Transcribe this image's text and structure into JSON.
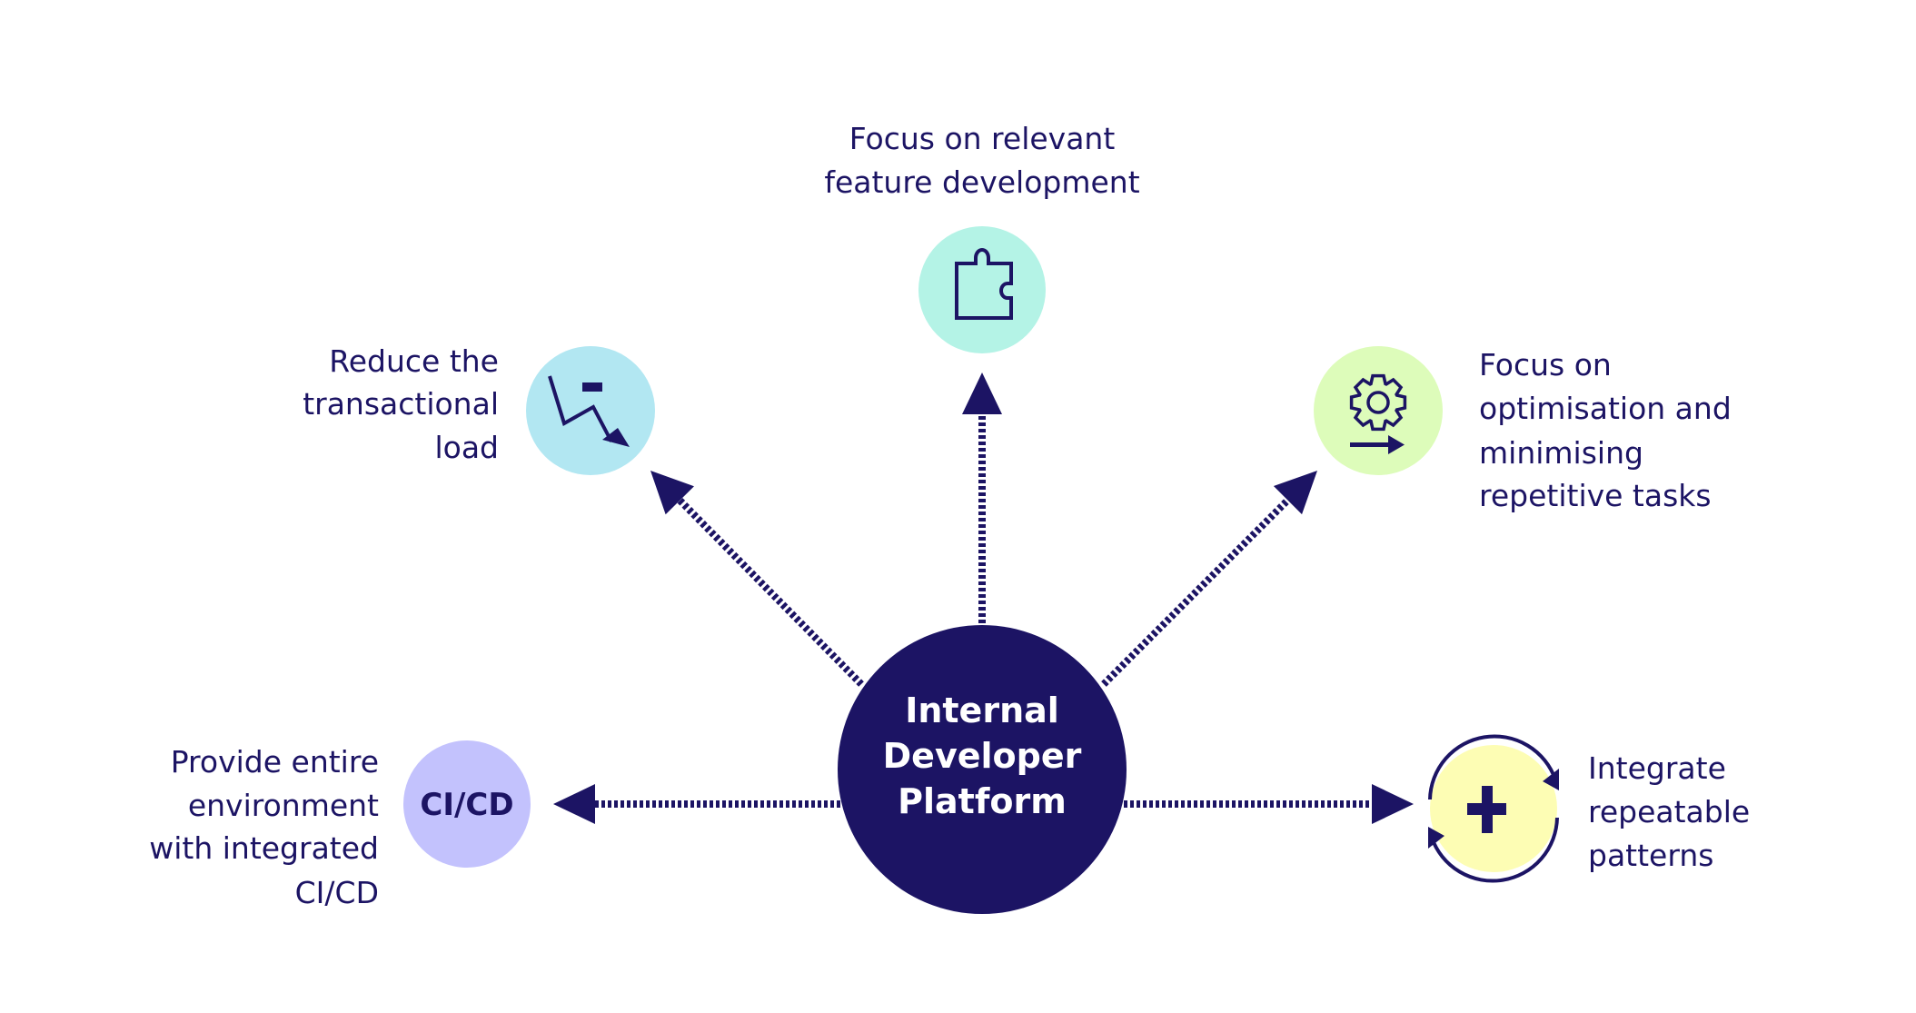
{
  "colors": {
    "primary": "#1c1464",
    "puzzle_circle": "#b4f3e6",
    "trend_circle": "#b2e7f2",
    "gear_circle": "#ddfcba",
    "cicd_circle": "#c3c2fd",
    "plus_circle": "#fdfdb4"
  },
  "center": {
    "lines": [
      "Internal",
      "Developer",
      "Platform"
    ]
  },
  "nodes": {
    "feature": {
      "icon": "puzzle-icon",
      "lines": [
        "Focus on relevant",
        "feature development"
      ]
    },
    "transactional": {
      "icon": "trend-down-icon",
      "lines": [
        "Reduce the",
        "transactional",
        "load"
      ]
    },
    "optimisation": {
      "icon": "gear-arrow-icon",
      "lines": [
        "Focus on",
        "optimisation and",
        "minimising",
        "repetitive tasks"
      ]
    },
    "cicd": {
      "icon_text": "CI/CD",
      "lines": [
        "Provide entire",
        "environment",
        "with integrated",
        "CI/CD"
      ]
    },
    "patterns": {
      "icon": "plus-cycle-icon",
      "lines": [
        "Integrate",
        "repeatable",
        "patterns"
      ]
    }
  }
}
